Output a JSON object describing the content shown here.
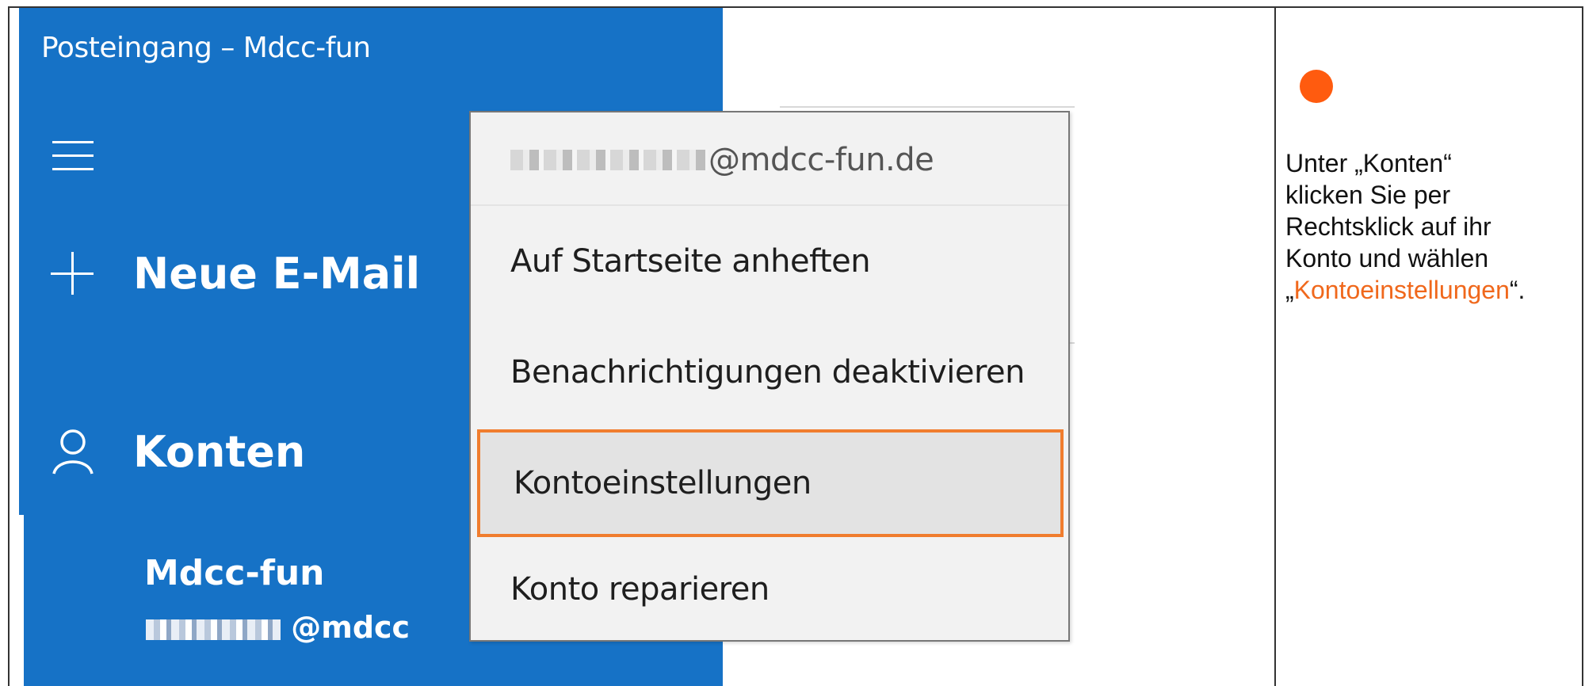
{
  "app": {
    "title": "Posteingang – Mdcc-fun"
  },
  "sidebar": {
    "new_mail_label": "Neue E-Mail",
    "accounts_label": "Konten",
    "account": {
      "name": "Mdcc-fun",
      "email_suffix": "@mdcc"
    }
  },
  "context_menu": {
    "email_suffix": "@mdcc-fun.de",
    "items": [
      {
        "label": "Auf Startseite anheften"
      },
      {
        "label": "Benachrichtigungen deaktivieren"
      },
      {
        "label": "Kontoeinstellungen",
        "highlighted": true
      },
      {
        "label": "Konto reparieren"
      }
    ]
  },
  "instruction": {
    "line1": "Unter „Konten“",
    "line2": "klicken Sie per",
    "line3": "Rechtsklick auf ihr",
    "line4": "Konto und wählen",
    "quote_open": "„",
    "highlight": "Kontoeinstellungen",
    "quote_close": "“."
  },
  "colors": {
    "sidebar": "#1672c6",
    "accent_orange": "#f07d2e",
    "dot": "#ff5b0f"
  },
  "icons": [
    "hamburger-icon",
    "plus-icon",
    "person-icon"
  ]
}
